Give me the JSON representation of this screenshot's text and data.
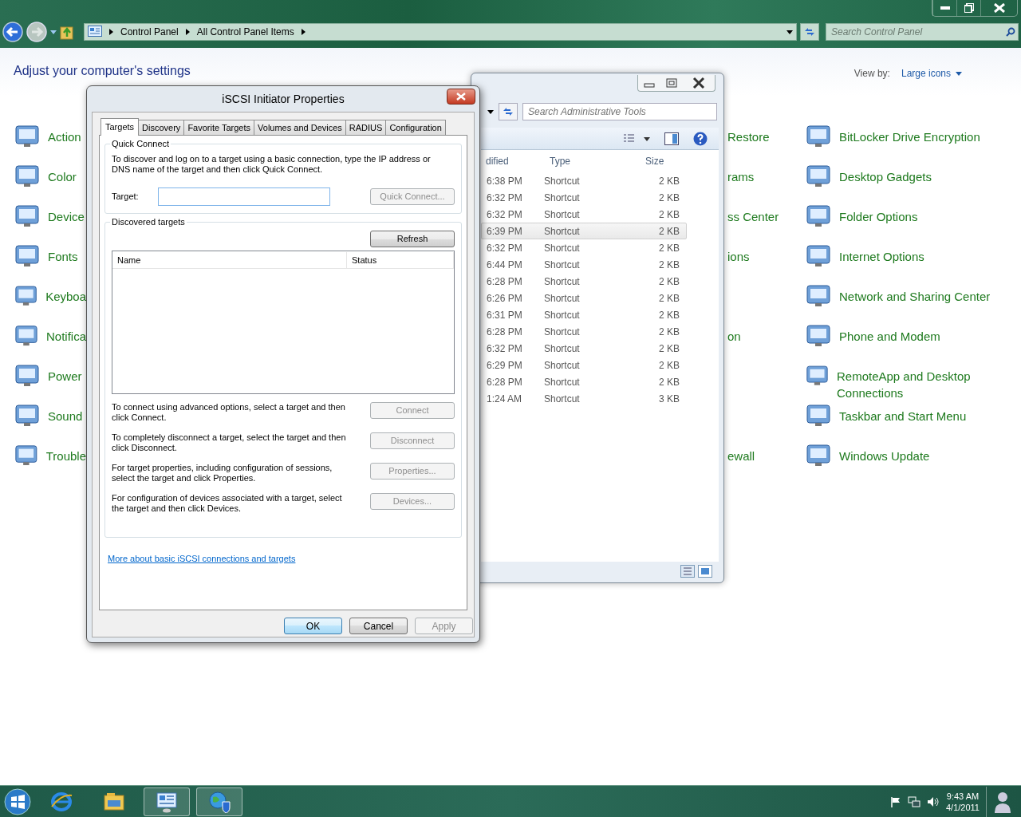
{
  "control_panel": {
    "breadcrumb": [
      "Control Panel",
      "All Control Panel Items"
    ],
    "search": {
      "placeholder": "Search Control Panel"
    },
    "heading": "Adjust your computer's settings",
    "view_by": {
      "label": "View by:",
      "value": "Large icons"
    },
    "items": [
      {
        "left": "Action",
        "middle": "Restore",
        "right": "BitLocker Drive Encryption"
      },
      {
        "left": "Color",
        "middle": "rams",
        "right": "Desktop Gadgets"
      },
      {
        "left": "Device",
        "middle": "ss Center",
        "right": "Folder Options"
      },
      {
        "left": "Fonts",
        "middle": "ions",
        "right": "Internet Options"
      },
      {
        "left": "Keyboa",
        "right": "Network and Sharing Center"
      },
      {
        "left": "Notifica",
        "middle": "on",
        "right": "Phone and Modem"
      },
      {
        "left": "Power",
        "right": "RemoteApp and Desktop Connections"
      },
      {
        "left": "Sound",
        "right": "Taskbar and Start Menu"
      },
      {
        "left": "Trouble",
        "middle": "ewall",
        "right": "Windows Update"
      }
    ]
  },
  "admin_window": {
    "search": {
      "placeholder": "Search Administrative Tools"
    },
    "columns": [
      "dified",
      "Type",
      "Size"
    ],
    "rows": [
      {
        "modified": "6:38 PM",
        "type": "Shortcut",
        "size": "2 KB",
        "selected": false
      },
      {
        "modified": "6:32 PM",
        "type": "Shortcut",
        "size": "2 KB",
        "selected": false
      },
      {
        "modified": "6:32 PM",
        "type": "Shortcut",
        "size": "2 KB",
        "selected": false
      },
      {
        "modified": "6:39 PM",
        "type": "Shortcut",
        "size": "2 KB",
        "selected": true
      },
      {
        "modified": "6:32 PM",
        "type": "Shortcut",
        "size": "2 KB",
        "selected": false
      },
      {
        "modified": "6:44 PM",
        "type": "Shortcut",
        "size": "2 KB",
        "selected": false
      },
      {
        "modified": "6:28 PM",
        "type": "Shortcut",
        "size": "2 KB",
        "selected": false
      },
      {
        "modified": "6:26 PM",
        "type": "Shortcut",
        "size": "2 KB",
        "selected": false
      },
      {
        "modified": "6:31 PM",
        "type": "Shortcut",
        "size": "2 KB",
        "selected": false
      },
      {
        "modified": "6:28 PM",
        "type": "Shortcut",
        "size": "2 KB",
        "selected": false
      },
      {
        "modified": "6:32 PM",
        "type": "Shortcut",
        "size": "2 KB",
        "selected": false
      },
      {
        "modified": "6:29 PM",
        "type": "Shortcut",
        "size": "2 KB",
        "selected": false
      },
      {
        "modified": "6:28 PM",
        "type": "Shortcut",
        "size": "2 KB",
        "selected": false
      },
      {
        "modified": "1:24 AM",
        "type": "Shortcut",
        "size": "3 KB",
        "selected": false
      }
    ]
  },
  "dialog": {
    "title": "iSCSI Initiator Properties",
    "tabs": [
      {
        "label": "Targets",
        "selected": true
      },
      {
        "label": "Discovery",
        "selected": false
      },
      {
        "label": "Favorite Targets",
        "selected": false
      },
      {
        "label": "Volumes and Devices",
        "selected": false
      },
      {
        "label": "RADIUS",
        "selected": false
      },
      {
        "label": "Configuration",
        "selected": false
      }
    ],
    "quick_connect": {
      "legend": "Quick Connect",
      "description": "To discover and log on to a target using a basic connection, type the IP address or DNS name of the target and then click Quick Connect.",
      "target_label": "Target:",
      "button": {
        "label": "Quick Connect...",
        "disabled": true
      }
    },
    "discovered": {
      "legend": "Discovered targets",
      "refresh": {
        "label": "Refresh",
        "disabled": false
      },
      "columns": [
        "Name",
        "Status"
      ],
      "actions": [
        {
          "text": "To connect using advanced options, select a target and then click Connect.",
          "button": {
            "label": "Connect",
            "disabled": true
          }
        },
        {
          "text": "To completely disconnect a target, select the target and then click Disconnect.",
          "button": {
            "label": "Disconnect",
            "disabled": true
          }
        },
        {
          "text": "For target properties, including configuration of sessions, select the target and click Properties.",
          "button": {
            "label": "Properties...",
            "disabled": true
          }
        },
        {
          "text": "For configuration of devices associated with a target, select the target and then click Devices.",
          "button": {
            "label": "Devices...",
            "disabled": true
          }
        }
      ]
    },
    "link": "More about basic iSCSI connections and targets",
    "buttons": [
      {
        "label": "OK",
        "disabled": false,
        "default": true
      },
      {
        "label": "Cancel",
        "disabled": false,
        "default": false
      },
      {
        "label": "Apply",
        "disabled": true,
        "default": false
      }
    ]
  },
  "taskbar": {
    "apps": [
      {
        "kind": "browser",
        "open": false
      },
      {
        "kind": "folder",
        "open": false
      },
      {
        "kind": "control-panel",
        "open": true
      },
      {
        "kind": "network",
        "open": true
      }
    ],
    "time": "9:43 AM",
    "date": "4/1/2011"
  }
}
